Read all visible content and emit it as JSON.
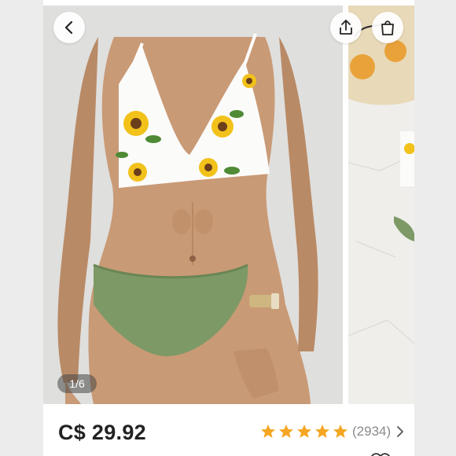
{
  "gallery": {
    "counter": "1/6",
    "icons": {
      "back": "chevron-left-icon",
      "share": "share-icon",
      "bag": "shopping-bag-icon"
    }
  },
  "product": {
    "price": "C$ 29.92",
    "rating": 5,
    "review_count": "(2934)"
  },
  "colors": {
    "star": "#f5a623",
    "bikini_bottom": "#7d9966",
    "sunflower": "#f2c21b"
  }
}
